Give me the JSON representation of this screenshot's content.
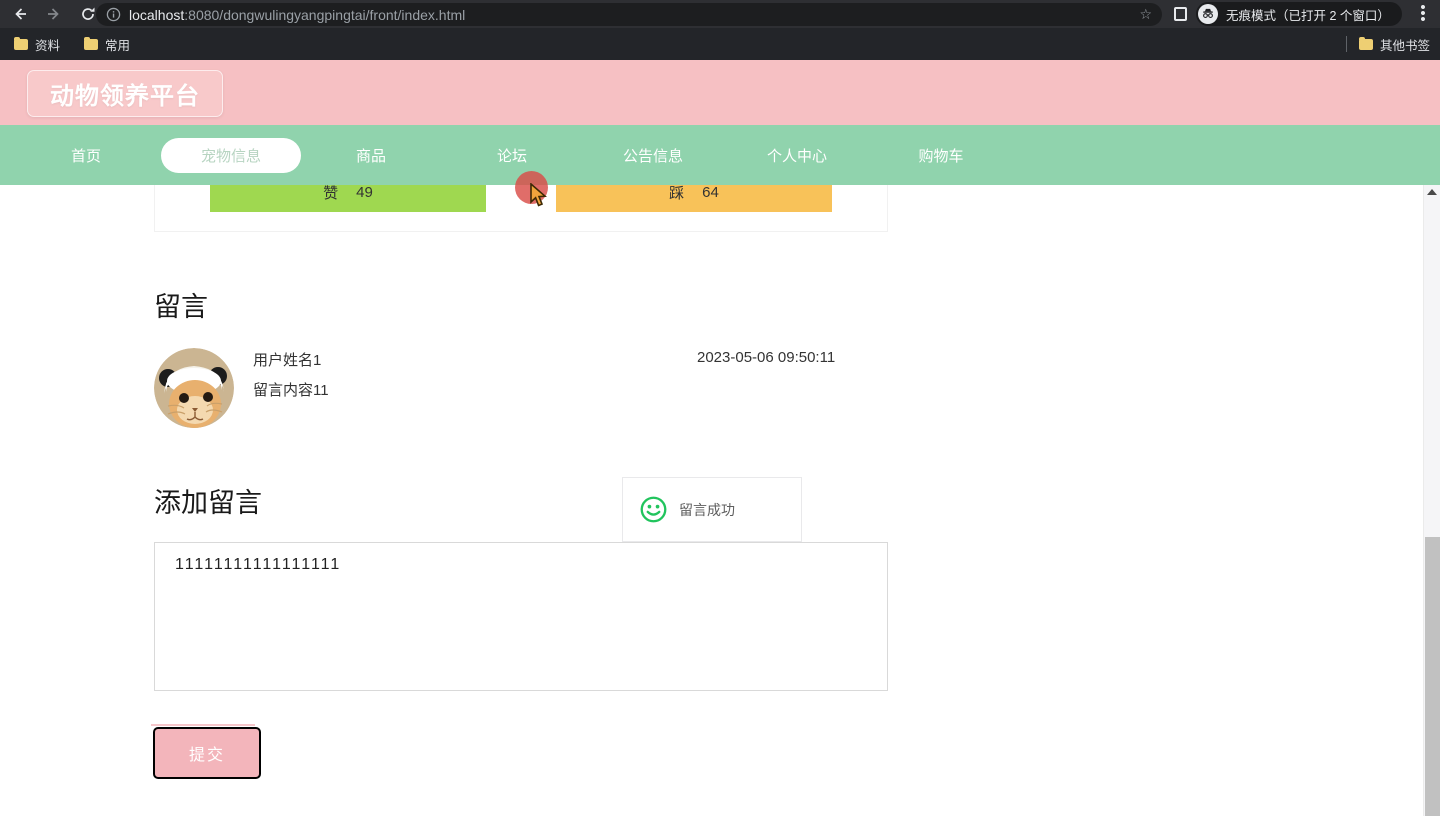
{
  "browser": {
    "url": {
      "host": "localhost",
      "rest": ":8080/dongwulingyangpingtai/front/index.html"
    },
    "incognito_label": "无痕模式（已打开 2 个窗口）",
    "bookmarks": [
      {
        "label": "资料"
      },
      {
        "label": "常用"
      }
    ],
    "other_bookmarks_label": "其他书签"
  },
  "header": {
    "title": "动物领养平台"
  },
  "nav": {
    "items": [
      {
        "label": "首页"
      },
      {
        "label": "宠物信息",
        "active": true
      },
      {
        "label": "商品"
      },
      {
        "label": "论坛"
      },
      {
        "label": "公告信息"
      },
      {
        "label": "个人中心"
      },
      {
        "label": "购物车"
      }
    ]
  },
  "votes": {
    "like_label": "赞",
    "like_count": "49",
    "dislike_label": "踩",
    "dislike_count": "64"
  },
  "comments": {
    "heading": "留言",
    "items": [
      {
        "user": "用户姓名1",
        "content": "留言内容11",
        "time": "2023-05-06 09:50:11"
      }
    ]
  },
  "add_comment": {
    "heading": "添加留言",
    "textarea_value": "11111111111111111",
    "submit_label": "提交"
  },
  "toast": {
    "message": "留言成功",
    "icon": "smiley-success-icon"
  },
  "colors": {
    "header_pink": "#f6c0c3",
    "nav_green": "#90d3ad",
    "like_green": "#9fd850",
    "dislike_orange": "#f8c259",
    "button_pink": "#f3b5bb",
    "toast_icon_green": "#21c45d"
  }
}
